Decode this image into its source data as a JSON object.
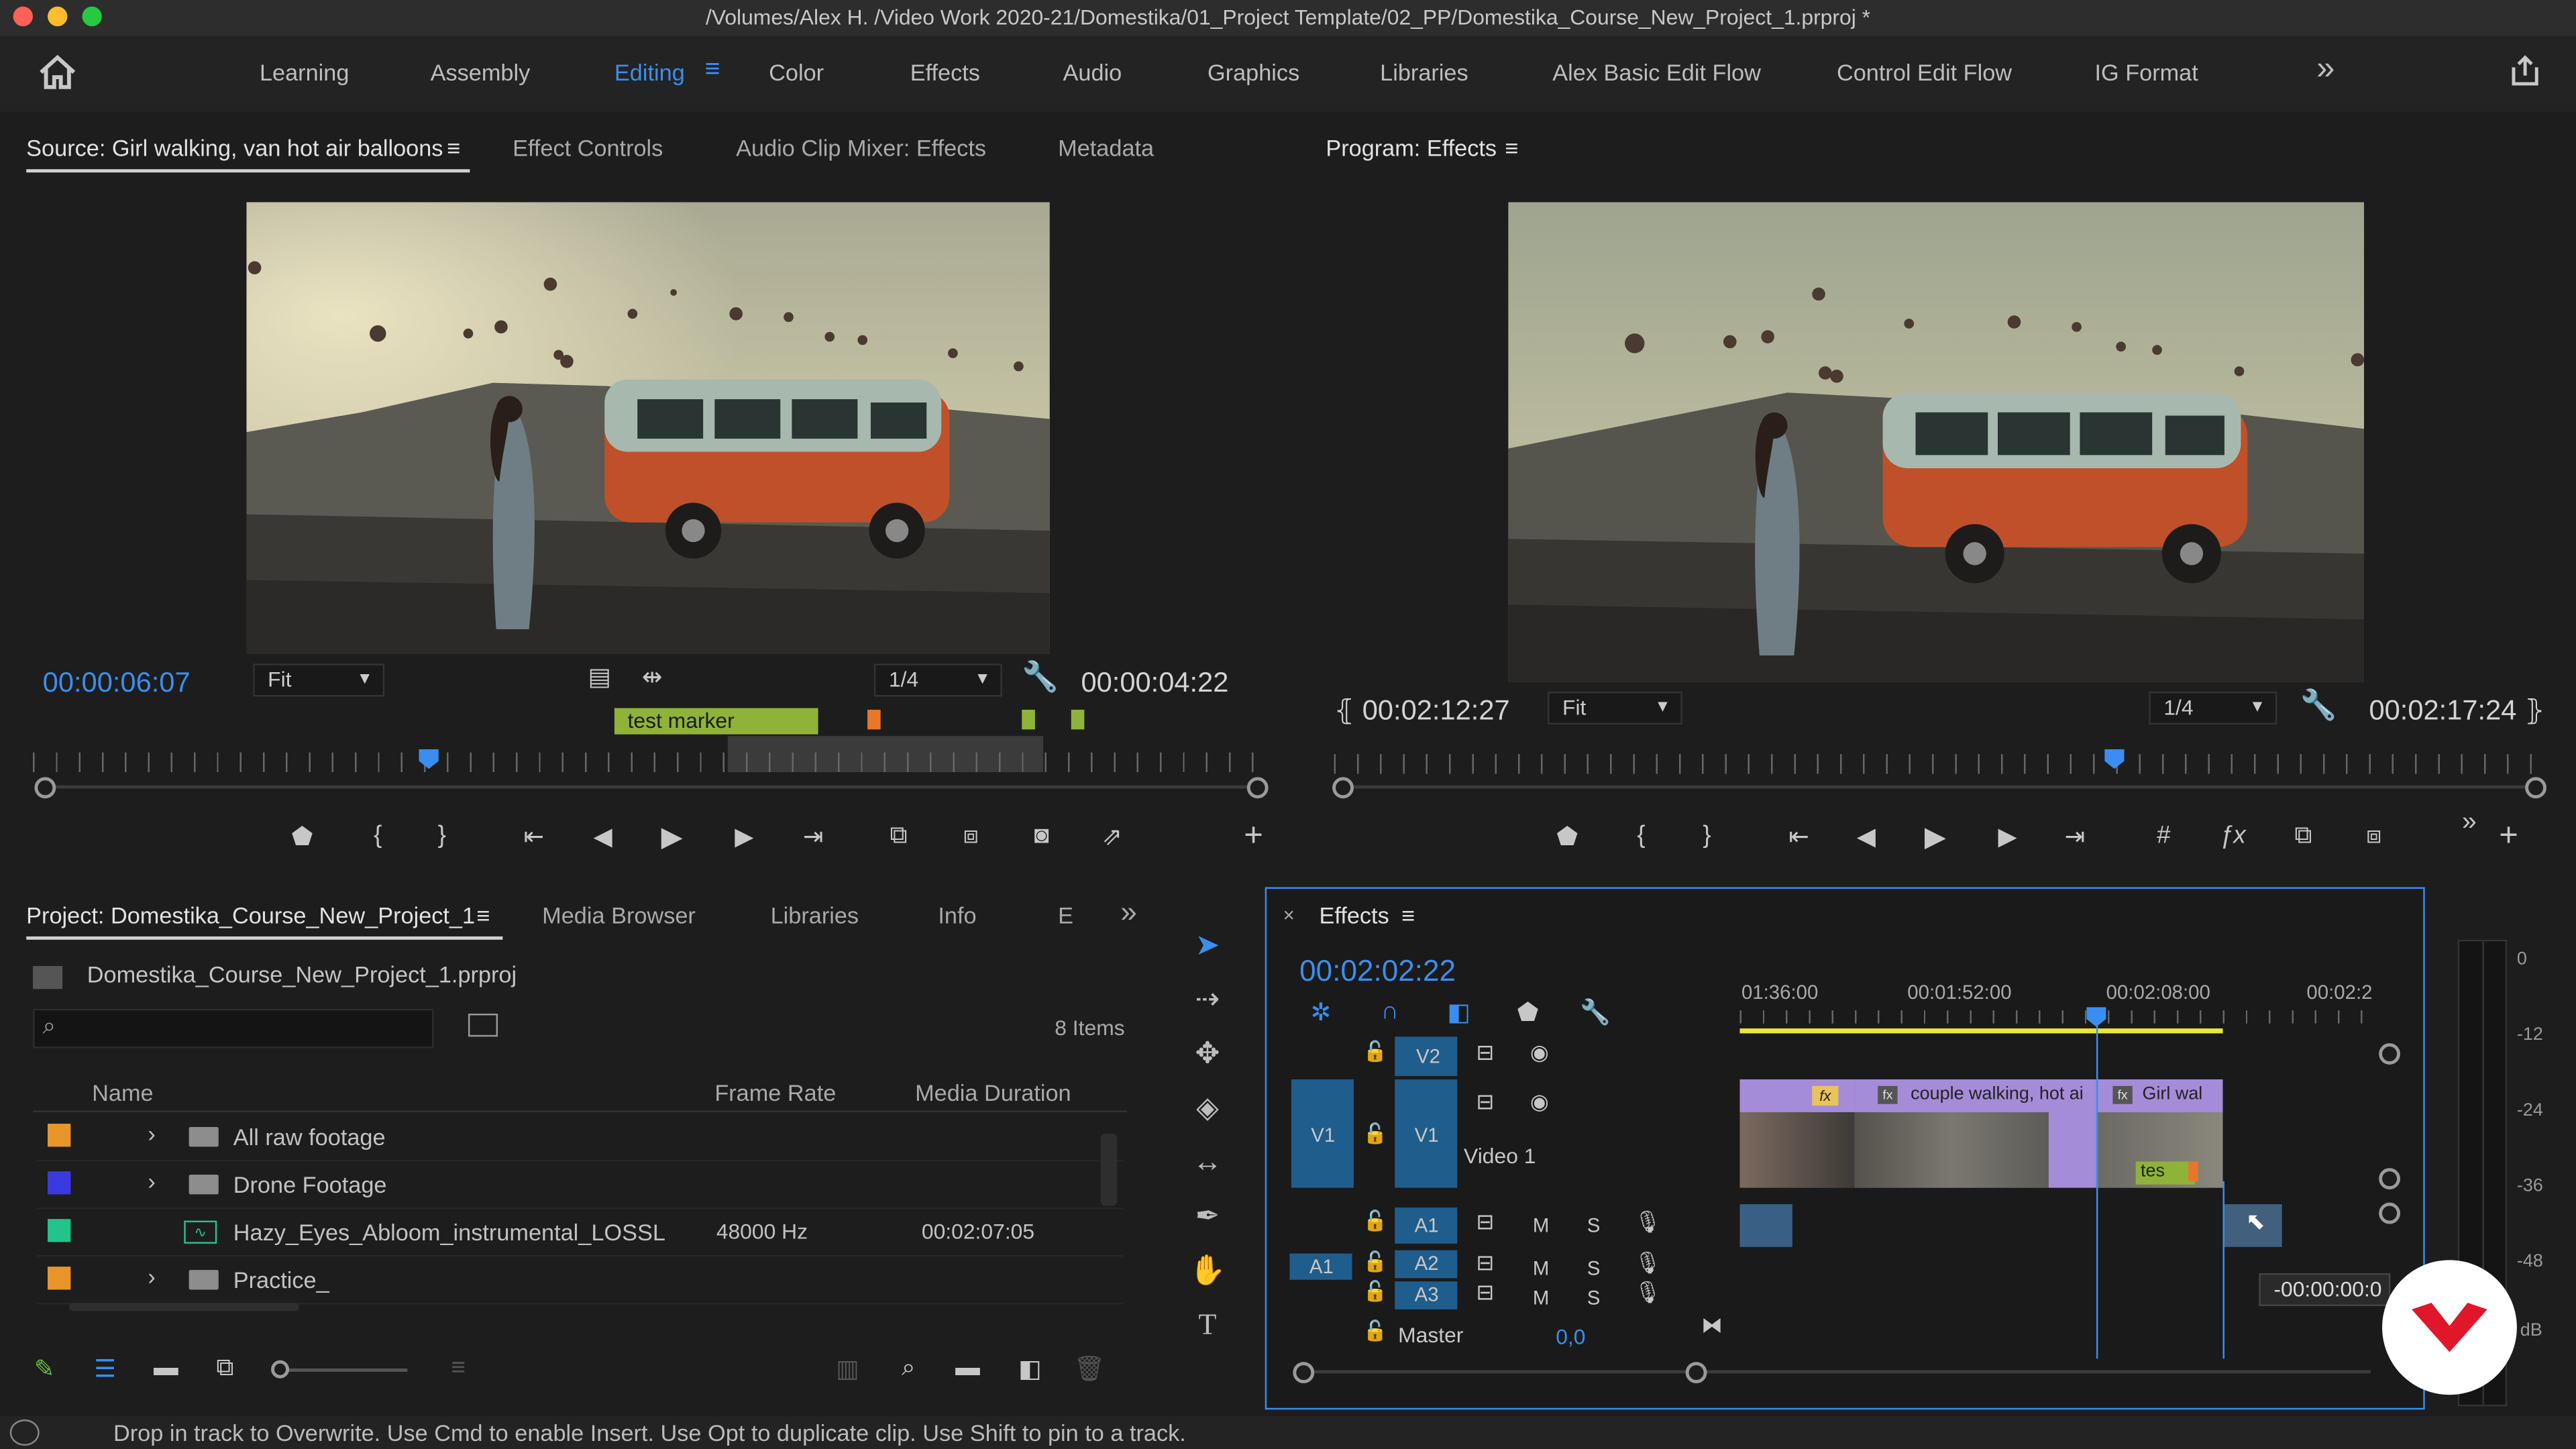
{
  "window": {
    "title": "/Volumes/Alex H. /Video Work 2020-21/Domestika/01_Project Template/02_PP/Domestika_Course_New_Project_1.prproj *"
  },
  "workspaces": [
    "Learning",
    "Assembly",
    "Editing",
    "Color",
    "Effects",
    "Audio",
    "Graphics",
    "Libraries",
    "Alex Basic Edit Flow",
    "Control Edit Flow",
    "IG Format"
  ],
  "workspace_active": "Editing",
  "overflow_glyph": "»",
  "source": {
    "tabs": [
      "Source: Girl walking, van hot air balloons",
      "Effect Controls",
      "Audio Clip Mixer: Effects",
      "Metadata"
    ],
    "timecode": "00:00:06:07",
    "fit": "Fit",
    "resolution": "1/4",
    "duration": "00:00:04:22",
    "marker_label": "test marker"
  },
  "program": {
    "title": "Program: Effects",
    "timecode": "00:02:12:27",
    "fit": "Fit",
    "resolution": "1/4",
    "duration": "00:02:17:24"
  },
  "project": {
    "tabs": [
      "Project: Domestika_Course_New_Project_1",
      "Media Browser",
      "Libraries",
      "Info",
      "E"
    ],
    "file": "Domestika_Course_New_Project_1.prproj",
    "items_count": "8 Items",
    "columns": [
      "Name",
      "Frame Rate",
      "Media Duration"
    ],
    "rows": [
      {
        "name": "All raw footage",
        "frame_rate": "",
        "duration": "",
        "color": "#e8962b",
        "type": "folder"
      },
      {
        "name": "Drone Footage",
        "frame_rate": "",
        "duration": "",
        "color": "#3a3ae0",
        "type": "folder"
      },
      {
        "name": "Hazy_Eyes_Abloom_instrumental_LOSSL",
        "frame_rate": "48000 Hz",
        "duration": "00:02:07:05",
        "color": "#22c48a",
        "type": "audio"
      },
      {
        "name": "Practice_",
        "frame_rate": "",
        "duration": "",
        "color": "#e8962b",
        "type": "folder"
      }
    ]
  },
  "timeline": {
    "tab": "Effects",
    "timecode": "00:02:02:22",
    "ruler": [
      "01:36:00",
      "00:01:52:00",
      "00:02:08:00",
      "00:02:2"
    ],
    "tracks": {
      "v2": "V2",
      "v1": "V1",
      "video1": "Video 1",
      "a1": "A1",
      "a2": "A2",
      "a3": "A3",
      "master": "Master",
      "master_value": "0,0",
      "m": "M",
      "s": "S"
    },
    "clips": [
      "couple walking, hot ai",
      "Girl wal",
      "tes"
    ],
    "fx": "fx",
    "drag_timecode": "-00:00:00:0"
  },
  "meter": {
    "labels": [
      "0",
      "-12",
      "-24",
      "-36",
      "-48",
      "dB"
    ]
  },
  "status": "Drop in track to Overwrite. Use Cmd to enable Insert. Use Opt to duplicate clip. Use Shift to pin to a track.",
  "colors": {
    "accent": "#3b8ef0",
    "marker_green": "#8fb339",
    "clip_purple": "#a58cd8",
    "track_blue": "#1f5d8c"
  }
}
